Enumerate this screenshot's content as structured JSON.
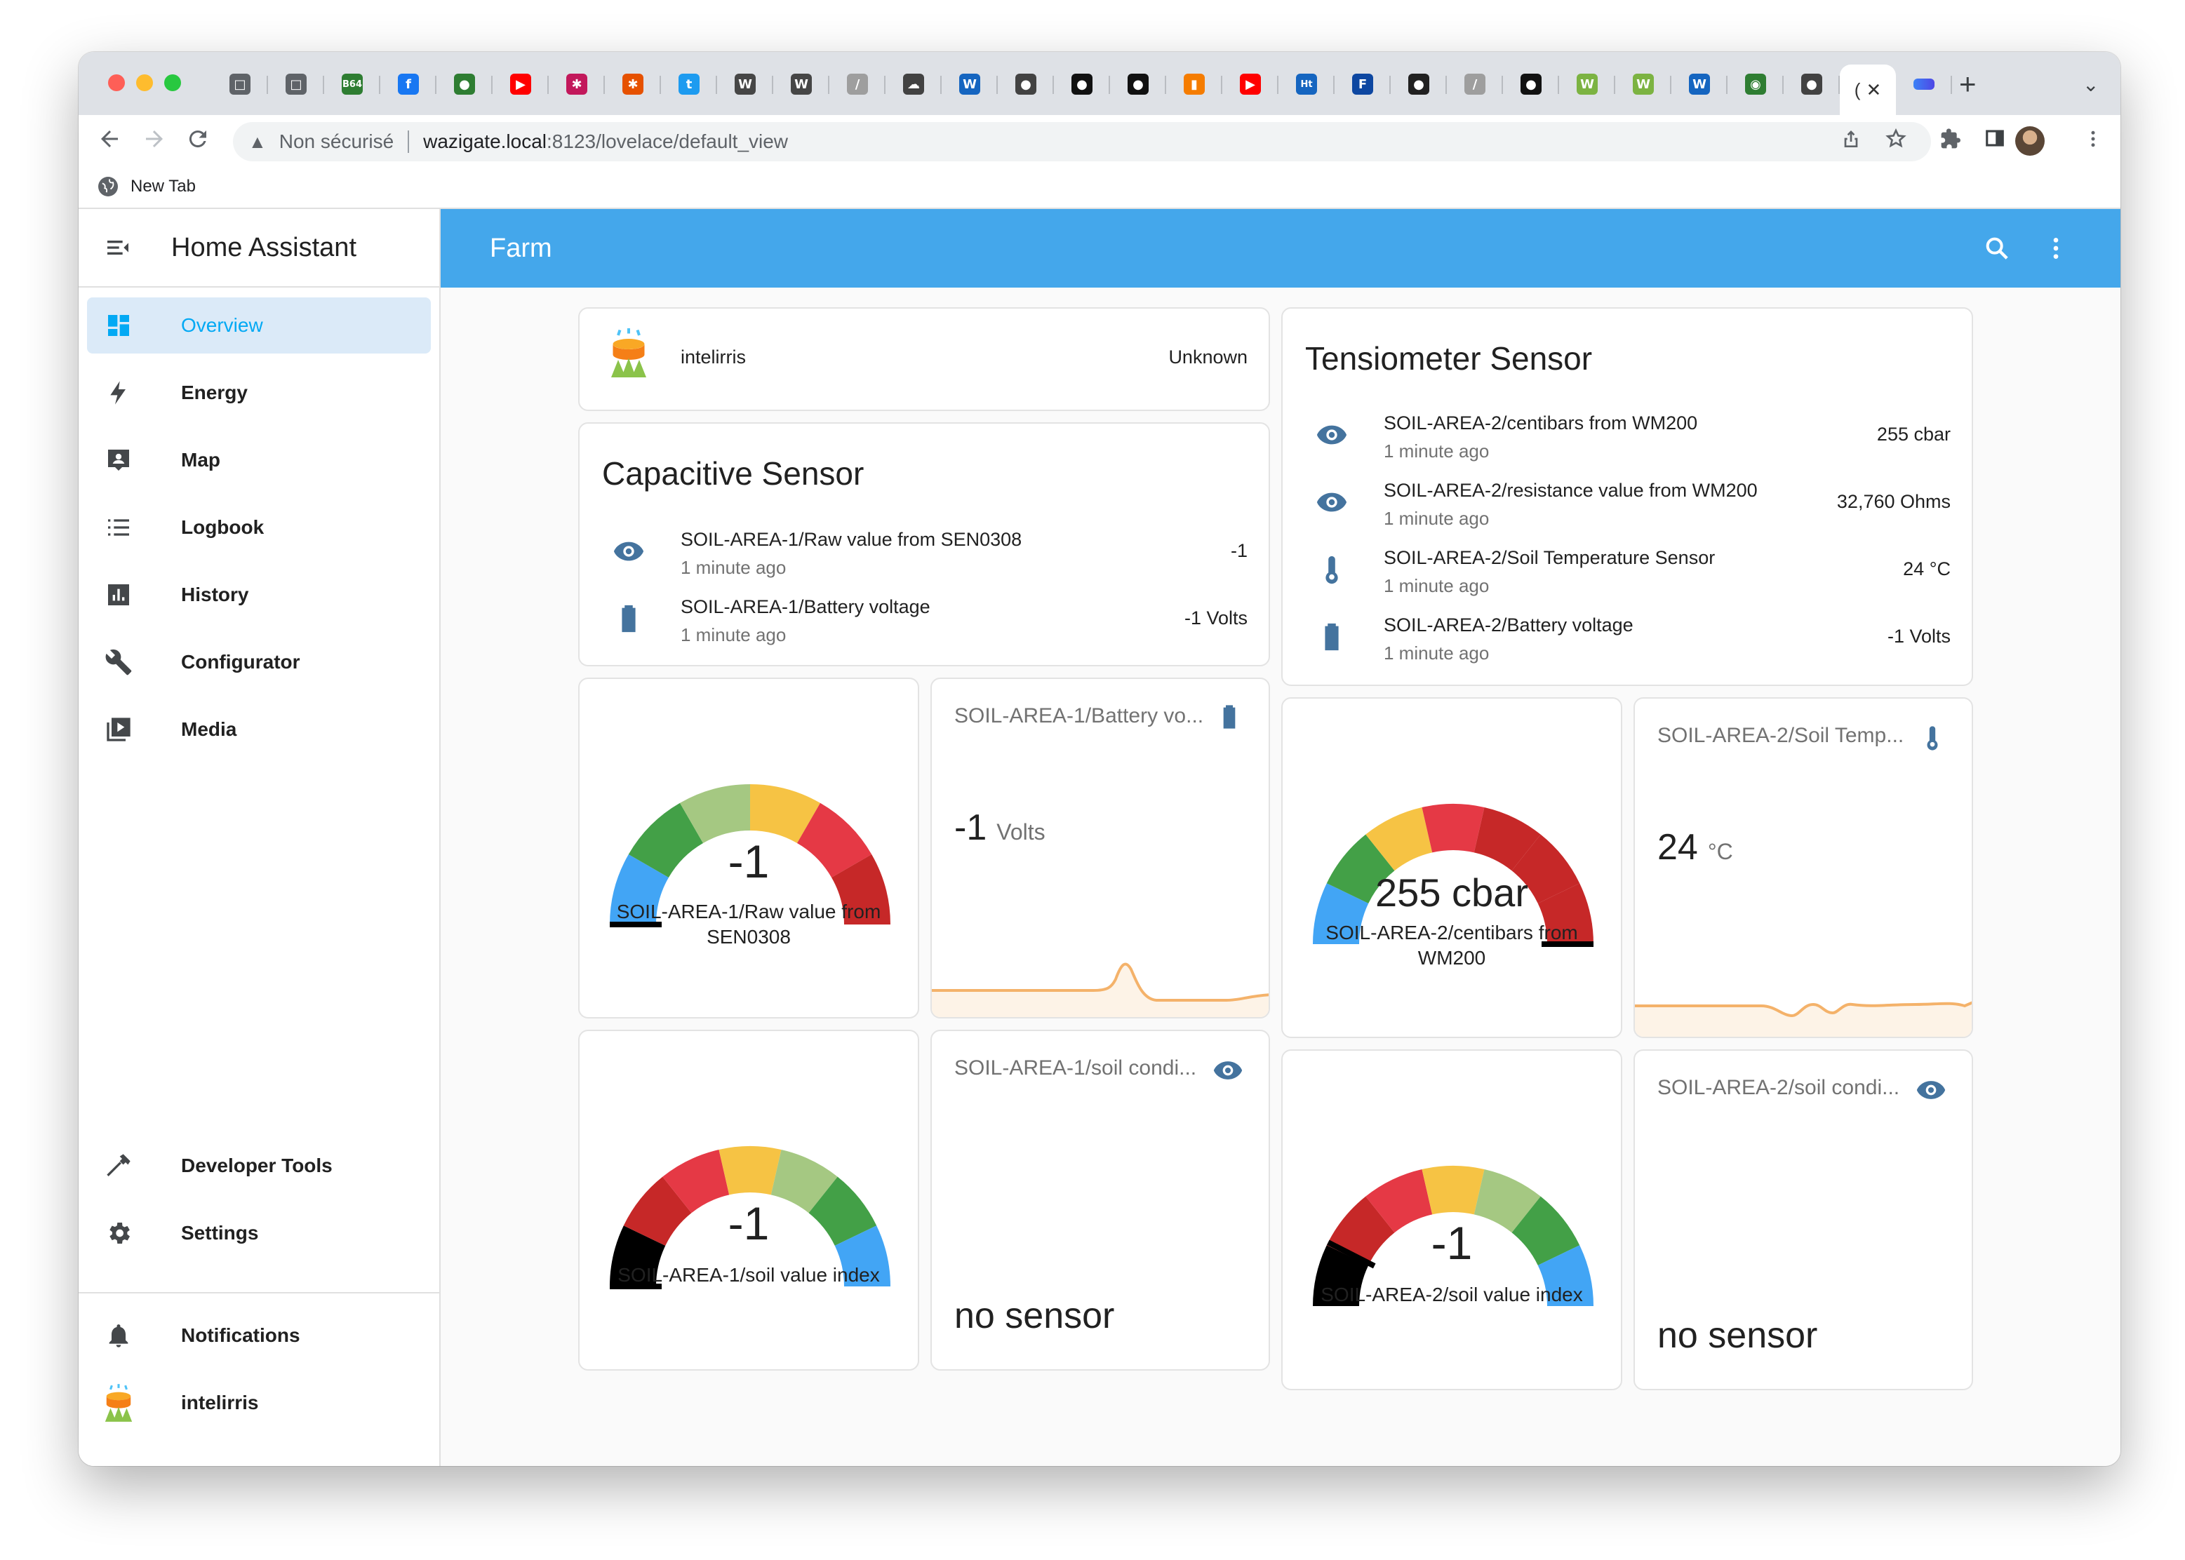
{
  "browser": {
    "tabs": [
      {
        "icon": "chat-icon",
        "color": "#5f6368",
        "glyph": "□"
      },
      {
        "icon": "chat-icon",
        "color": "#5f6368",
        "glyph": "□"
      },
      {
        "icon": "b64-icon",
        "color": "#2e7d32",
        "glyph": "B64"
      },
      {
        "icon": "facebook-icon",
        "color": "#1877f2",
        "glyph": "f"
      },
      {
        "icon": "globe-icon",
        "color": "#2e7d32",
        "glyph": "●"
      },
      {
        "icon": "youtube-icon",
        "color": "#ff0000",
        "glyph": "▶"
      },
      {
        "icon": "snowflake-icon",
        "color": "#c2185b",
        "glyph": "✱"
      },
      {
        "icon": "snowflake-icon",
        "color": "#e65100",
        "glyph": "✱"
      },
      {
        "icon": "twitter-icon",
        "color": "#1d9bf0",
        "glyph": "t"
      },
      {
        "icon": "wordpress-icon",
        "color": "#464646",
        "glyph": "W"
      },
      {
        "icon": "wordpress-icon",
        "color": "#464646",
        "glyph": "W"
      },
      {
        "icon": "slash-icon",
        "color": "#9e9e9e",
        "glyph": "/"
      },
      {
        "icon": "cloud-icon",
        "color": "#424242",
        "glyph": "☁"
      },
      {
        "icon": "w-icon",
        "color": "#1565c0",
        "glyph": "W"
      },
      {
        "icon": "globe-icon",
        "color": "#424242",
        "glyph": "●"
      },
      {
        "icon": "github-icon",
        "color": "#111111",
        "glyph": "●"
      },
      {
        "icon": "github-icon",
        "color": "#111111",
        "glyph": "●"
      },
      {
        "icon": "chart-icon",
        "color": "#f57c00",
        "glyph": "▮"
      },
      {
        "icon": "youtube-icon",
        "color": "#ff0000",
        "glyph": "▶"
      },
      {
        "icon": "ht-icon",
        "color": "#1565c0",
        "glyph": "Ht"
      },
      {
        "icon": "doc-icon",
        "color": "#0d47a1",
        "glyph": "F"
      },
      {
        "icon": "drop-icon",
        "color": "#212121",
        "glyph": "●"
      },
      {
        "icon": "slash-icon",
        "color": "#9e9e9e",
        "glyph": "/"
      },
      {
        "icon": "github-icon",
        "color": "#111111",
        "glyph": "●"
      },
      {
        "icon": "wa-icon",
        "color": "#7cb342",
        "glyph": "W"
      },
      {
        "icon": "wa-icon",
        "color": "#7cb342",
        "glyph": "W"
      },
      {
        "icon": "w-icon",
        "color": "#1565c0",
        "glyph": "W"
      },
      {
        "icon": "eye-icon",
        "color": "#2e7d32",
        "glyph": "◉"
      },
      {
        "icon": "globe-icon",
        "color": "#424242",
        "glyph": "●"
      }
    ],
    "active_tab_glyph": "(",
    "active_tab_close": "✕",
    "extra_tab_icon": "stripe-icon",
    "new_tab_symbol": "+",
    "tab_menu_symbol": "⌄",
    "address": {
      "warning": "▲",
      "security_label": "Non sécurisé",
      "host": "wazigate.local",
      "path": ":8123/lovelace/default_view"
    },
    "bookmark": {
      "label": "New Tab"
    }
  },
  "sidebar": {
    "title": "Home Assistant",
    "items": [
      {
        "label": "Overview",
        "icon": "overview-icon",
        "active": true
      },
      {
        "label": "Energy",
        "icon": "energy-icon"
      },
      {
        "label": "Map",
        "icon": "map-icon"
      },
      {
        "label": "Logbook",
        "icon": "logbook-icon"
      },
      {
        "label": "History",
        "icon": "history-icon"
      },
      {
        "label": "Configurator",
        "icon": "wrench-icon"
      },
      {
        "label": "Media",
        "icon": "media-icon"
      }
    ],
    "bottom_items": [
      {
        "label": "Developer Tools",
        "icon": "hammer-icon"
      },
      {
        "label": "Settings",
        "icon": "gear-icon"
      }
    ],
    "notifications": {
      "label": "Notifications",
      "icon": "bell-icon"
    },
    "user": {
      "label": "intelirris",
      "icon": "intelirris-avatar"
    }
  },
  "header": {
    "title": "Farm"
  },
  "cards": {
    "intelirris": {
      "name": "intelirris",
      "state": "Unknown"
    },
    "capacitive": {
      "title": "Capacitive Sensor",
      "rows": [
        {
          "name": "SOIL-AREA-1/Raw value from SEN0308",
          "time": "1 minute ago",
          "value": "-1",
          "icon": "eye-icon"
        },
        {
          "name": "SOIL-AREA-1/Battery voltage",
          "time": "1 minute ago",
          "value": "-1 Volts",
          "icon": "battery-icon"
        }
      ]
    },
    "tensiometer": {
      "title": "Tensiometer Sensor",
      "rows": [
        {
          "name": "SOIL-AREA-2/centibars from WM200",
          "time": "1 minute ago",
          "value": "255 cbar",
          "icon": "eye-icon"
        },
        {
          "name": "SOIL-AREA-2/resistance value from WM200",
          "time": "1 minute ago",
          "value": "32,760 Ohms",
          "icon": "eye-icon"
        },
        {
          "name": "SOIL-AREA-2/Soil Temperature Sensor",
          "time": "1 minute ago",
          "value": "24 °C",
          "icon": "thermometer-icon"
        },
        {
          "name": "SOIL-AREA-2/Battery voltage",
          "time": "1 minute ago",
          "value": "-1 Volts",
          "icon": "battery-icon"
        }
      ]
    },
    "gauge_raw": {
      "value": "-1",
      "label_line1": "SOIL-AREA-1/Raw value from",
      "label_line2": "SEN0308",
      "needle_fraction": 0.0
    },
    "battery1": {
      "name": "SOIL-AREA-1/Battery vo...",
      "value": "-1",
      "unit": "Volts",
      "icon": "battery-icon"
    },
    "gauge_cbar": {
      "value": "255 cbar",
      "label_line1": "SOIL-AREA-2/centibars from",
      "label_line2": "WM200",
      "needle_fraction": 1.0
    },
    "temp2": {
      "name": "SOIL-AREA-2/Soil Temp...",
      "value": "24",
      "unit": "°C",
      "icon": "thermometer-icon"
    },
    "gauge_index1": {
      "value": "-1",
      "label_line1": "SOIL-AREA-1/soil value index",
      "needle_fraction": 0.0
    },
    "cond1": {
      "name": "SOIL-AREA-1/soil condi...",
      "value": "no sensor",
      "icon": "eye-icon"
    },
    "gauge_index2": {
      "value": "-1",
      "label_line1": "SOIL-AREA-2/soil value index",
      "needle_fraction": 0.15
    },
    "cond2": {
      "name": "SOIL-AREA-2/soil condi...",
      "value": "no sensor",
      "icon": "eye-icon"
    }
  },
  "colors": {
    "accent": "#03a9f4",
    "header": "#44a7eb",
    "icon": "#44739e",
    "gauge_blue": "#42a5f5",
    "gauge_dkgreen": "#43a047",
    "gauge_ltgreen": "#a5c882",
    "gauge_yellow": "#f6c344",
    "gauge_red": "#e53945",
    "gauge_dkred": "#c62828",
    "gauge_black": "#000000",
    "spark_line": "#f4b26a",
    "spark_fill": "#fdf3e7"
  }
}
